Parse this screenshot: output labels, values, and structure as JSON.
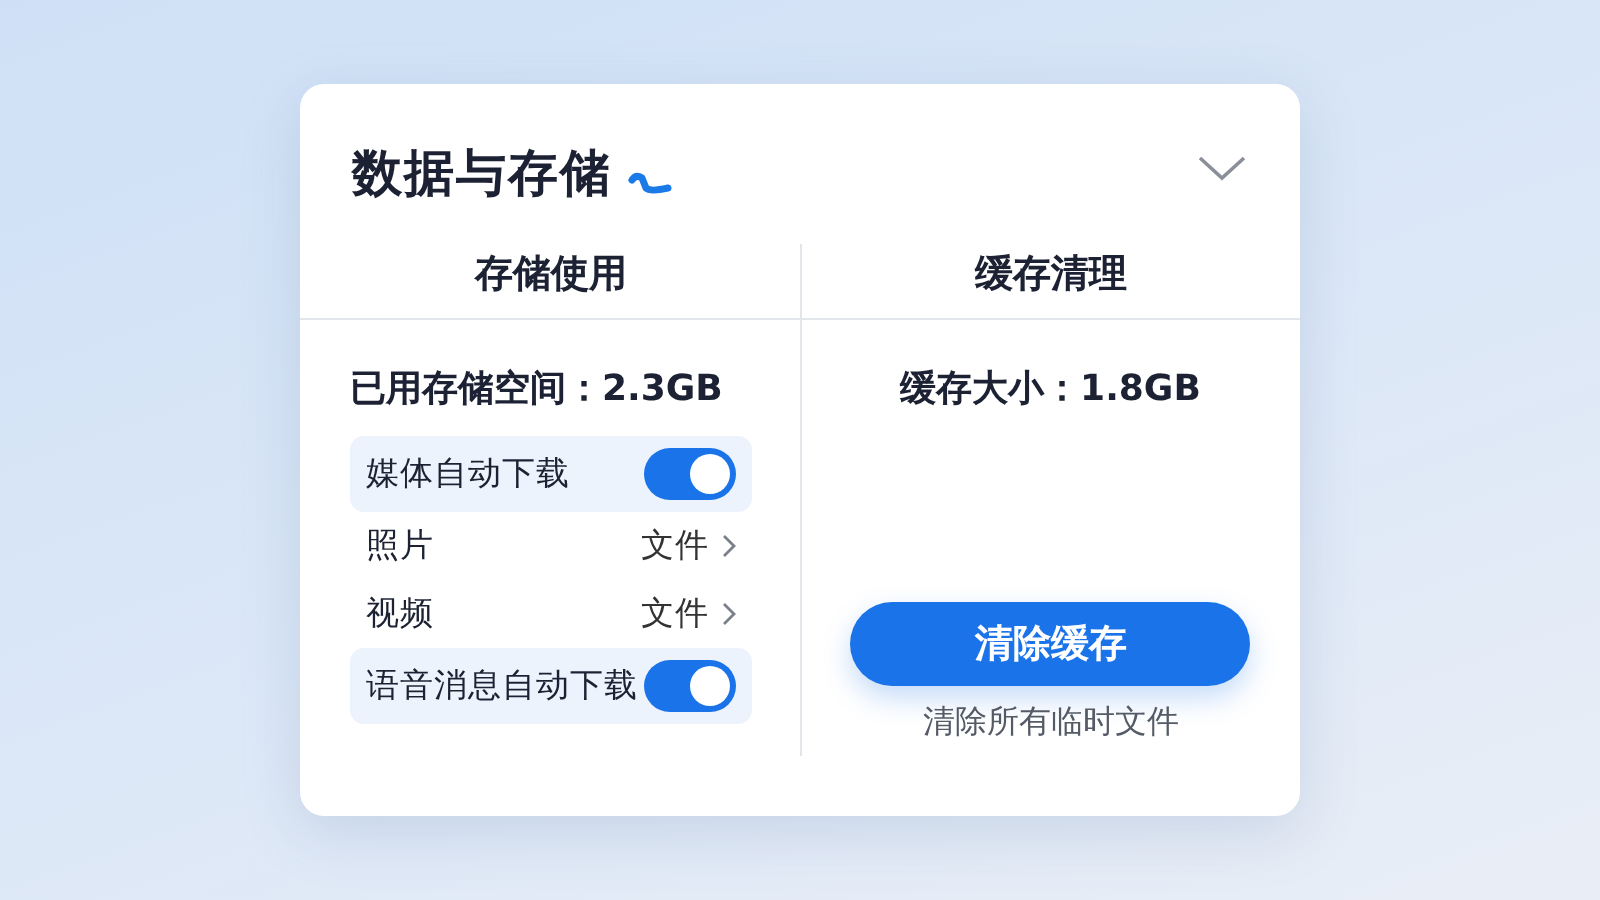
{
  "card": {
    "title": "数据与存储",
    "expanded": true
  },
  "columns": [
    {
      "heading": "存储使用"
    },
    {
      "heading": "缓存清理"
    }
  ],
  "storage": {
    "used": "已用存储空间：2.3GB",
    "rows": [
      {
        "kind": "toggle",
        "label": "媒体自动下载",
        "on": true
      },
      {
        "kind": "link",
        "label": "照片",
        "value": "文件"
      },
      {
        "kind": "link",
        "label": "视频",
        "value": "文件"
      },
      {
        "kind": "toggle",
        "label": "语音消息自动下载",
        "on": true
      }
    ]
  },
  "cache": {
    "size": "缓存大小：1.8GB",
    "button": "清除缓存",
    "note": "清除所有临时文件"
  }
}
